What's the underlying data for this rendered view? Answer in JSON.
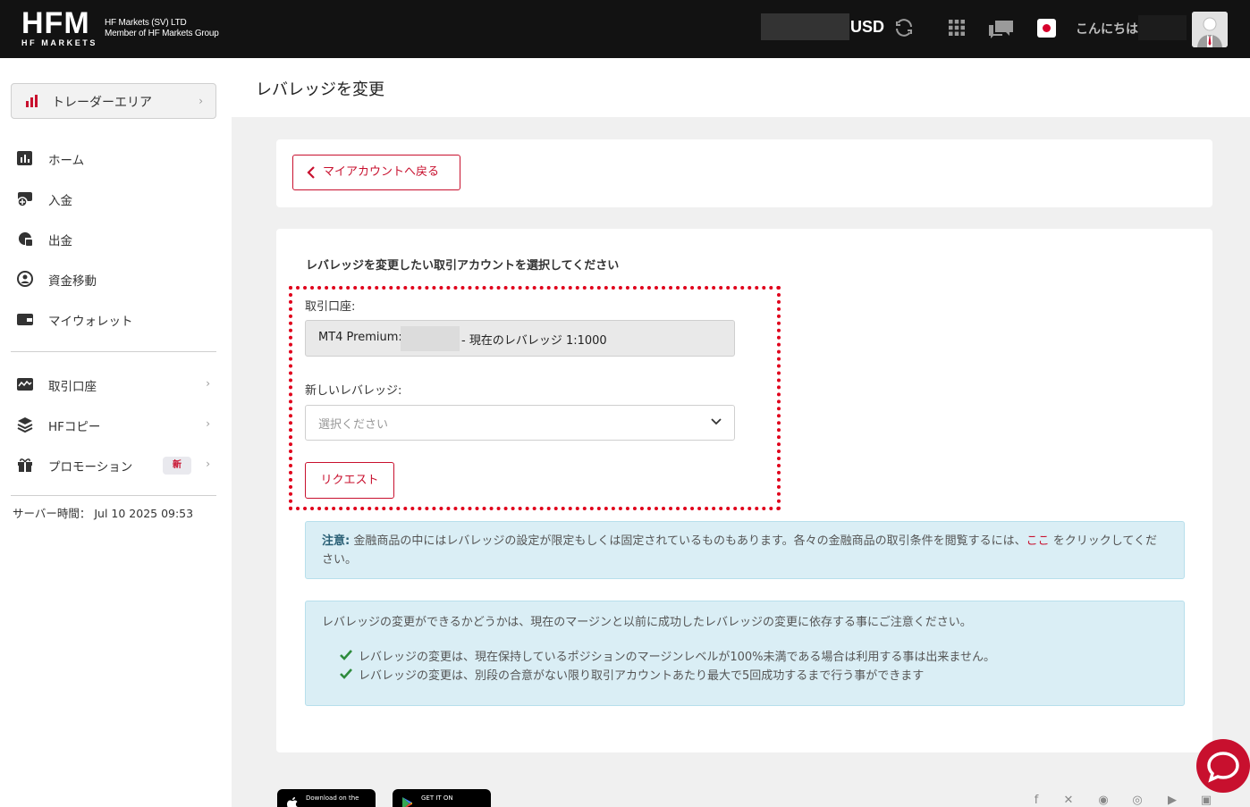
{
  "header": {
    "logo_text": "HFM",
    "logo_sub": "HF MARKETS",
    "company_line1": "HF Markets (SV) LTD",
    "company_line2": "Member of HF Markets Group",
    "currency": "USD",
    "greeting": "こんにちは"
  },
  "sidebar": {
    "trader_area": "トレーダーエリア",
    "items": [
      {
        "label": "ホーム",
        "icon": "chart-icon"
      },
      {
        "label": "入金",
        "icon": "deposit-icon"
      },
      {
        "label": "出金",
        "icon": "withdraw-icon"
      },
      {
        "label": "資金移動",
        "icon": "transfer-icon"
      },
      {
        "label": "マイウォレット",
        "icon": "wallet-icon"
      }
    ],
    "items2": [
      {
        "label": "取引口座",
        "icon": "trading-account-icon"
      },
      {
        "label": "HFコピー",
        "icon": "layers-icon"
      },
      {
        "label": "プロモーション",
        "icon": "gift-icon",
        "badge": "新"
      }
    ],
    "server_time": "サーバー時間： Jul 10 2025 09:53"
  },
  "page": {
    "title": "レバレッジを変更",
    "back_label": "マイアカウントへ戻る",
    "section_title": "レバレッジを変更したい取引アカウントを選択してください",
    "account_label": "取引口座:",
    "account_prefix": "MT4 Premium:",
    "account_suffix": "- 現在のレバレッジ 1:1000",
    "new_leverage_label": "新しいレバレッジ:",
    "select_placeholder": "選択ください",
    "request_label": "リクエスト",
    "note_bold": "注意:",
    "note_text": " 金融商品の中にはレバレッジの設定が限定もしくは固定されているものもあります。各々の金融商品の取引条件を閲覧するには、",
    "note_link": "ここ",
    "note_tail": " をクリックしてください。",
    "info_intro": "レバレッジの変更ができるかどうかは、現在のマージンと以前に成功したレバレッジの変更に依存する事にご注意ください。",
    "info_points": [
      "レバレッジの変更は、現在保持しているポジションのマージンレベルが100%未満である場合は利用する事は出来ません。",
      "レバレッジの変更は、別段の合意がない限り取引アカウントあたり最大で5回成功するまで行う事ができます"
    ]
  },
  "footer": {
    "app_store_small": "Download on the",
    "google_play_small": "GET IT ON"
  },
  "colors": {
    "brand_red": "#c8102e",
    "header_bg": "#121212",
    "info_bg": "#daeef5",
    "check_green": "#2e8b3d"
  }
}
